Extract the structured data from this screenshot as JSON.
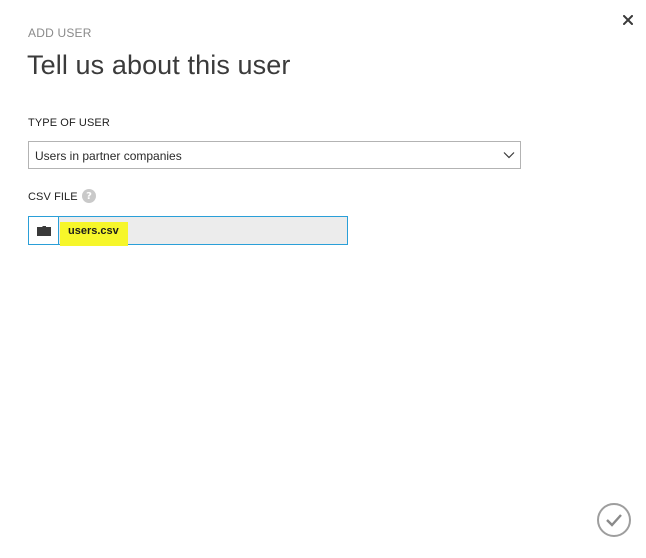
{
  "dialog": {
    "eyebrow": "ADD USER",
    "title": "Tell us about this user",
    "close_icon": "close-icon"
  },
  "type_of_user": {
    "label": "TYPE OF USER",
    "selected": "Users in partner companies",
    "chevron_icon": "chevron-down-icon"
  },
  "csv_file": {
    "label": "CSV FILE",
    "help_glyph": "?",
    "help_icon": "help-icon",
    "browse_icon": "folder-icon",
    "file_name": "users.csv",
    "highlight_color": "#f6f62a",
    "border_color": "#2a9fd8"
  },
  "footer": {
    "confirm_icon": "checkmark-icon"
  }
}
